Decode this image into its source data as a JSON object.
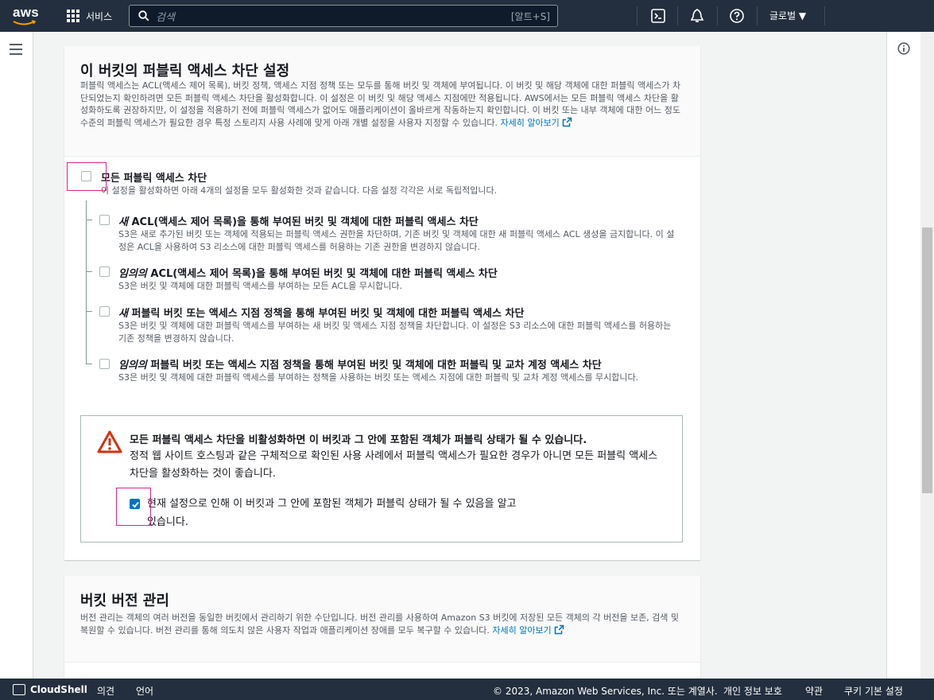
{
  "topnav": {
    "logo_text": "aws",
    "services_label": "서비스",
    "search_placeholder": "검색",
    "search_shortcut": "[알트+S]",
    "region_label": "글로벌 ▼",
    "icons": [
      "cloudshell-icon",
      "bell-icon",
      "help-icon"
    ]
  },
  "block_public_access": {
    "title": "이 버킷의 퍼블릭 액세스 차단 설정",
    "description": "퍼블릭 액세스는 ACL(액세스 제어 목록), 버킷 정책, 액세스 지점 정책 또는 모두를 통해 버킷 및 객체에 부여됩니다. 이 버킷 및 해당 객체에 대한 퍼블릭 액세스가 차단되었는지 확인하려면 모든 퍼블릭 액세스 차단을 활성화합니다. 이 설정은 이 버킷 및 해당 액세스 지점에만 적용됩니다. AWS에서는 모든 퍼블릭 액세스 차단을 활성화하도록 권장하지만, 이 설정을 적용하기 전에 퍼블릭 액세스가 없어도 애플리케이션이 올바르게 작동하는지 확인합니다. 이 버킷 또는 내부 객체에 대한 어느 정도 수준의 퍼블릭 액세스가 필요한 경우 특정 스토리지 사용 사례에 맞게 아래 개별 설정을 사용자 지정할 수 있습니다.",
    "learn_more": "자세히 알아보기",
    "block_all": {
      "label": "모든 퍼블릭 액세스 차단",
      "desc": "이 설정을 활성화하면 아래 4개의 설정을 모두 활성화한 것과 같습니다. 다음 설정 각각은 서로 독립적입니다.",
      "checked": false
    },
    "options": [
      {
        "em": "새",
        "label": " ACL(액세스 제어 목록)을 통해 부여된 버킷 및 객체에 대한 퍼블릭 액세스 차단",
        "desc": "S3은 새로 추가된 버킷 또는 객체에 적용되는 퍼블릭 액세스 권한을 차단하며, 기존 버킷 및 객체에 대한 새 퍼블릭 액세스 ACL 생성을 금지합니다. 이 설정은 ACL을 사용하여 S3 리소스에 대한 퍼블릭 액세스를 허용하는 기존 권한을 변경하지 않습니다.",
        "checked": false
      },
      {
        "em": "임의의",
        "label": " ACL(액세스 제어 목록)을 통해 부여된 버킷 및 객체에 대한 퍼블릭 액세스 차단",
        "desc": "S3은 버킷 및 객체에 대한 퍼블릭 액세스를 부여하는 모든 ACL을 무시합니다.",
        "checked": false
      },
      {
        "em": "새",
        "label": " 퍼블릭 버킷 또는 액세스 지점 정책을 통해 부여된 버킷 및 객체에 대한 퍼블릭 액세스 차단",
        "desc": "S3은 버킷 및 객체에 대한 퍼블릭 액세스를 부여하는 새 버킷 및 액세스 지점 정책을 차단합니다. 이 설정은 S3 리소스에 대한 퍼블릭 액세스를 허용하는 기존 정책을 변경하지 않습니다.",
        "checked": false
      },
      {
        "em": "임의의",
        "label": " 퍼블릭 버킷 또는 액세스 지점 정책을 통해 부여된 버킷 및 객체에 대한 퍼블릭 및 교차 계정 액세스 차단",
        "desc": "S3은 버킷 및 객체에 대한 퍼블릭 액세스를 부여하는 정책을 사용하는 버킷 또는 액세스 지점에 대한 퍼블릭 및 교차 계정 액세스를 무시합니다.",
        "checked": false
      }
    ],
    "alert": {
      "title": "모든 퍼블릭 액세스 차단을 비활성화하면 이 버킷과 그 안에 포함된 객체가 퍼블릭 상태가 될 수 있습니다.",
      "desc": "정적 웹 사이트 호스팅과 같은 구체적으로 확인된 사용 사례에서 퍼블릭 액세스가 필요한 경우가 아니면 모든 퍼블릭 액세스 차단을 활성화하는 것이 좋습니다.",
      "ack_label": "현재 설정으로 인해 이 버킷과 그 안에 포함된 객체가 퍼블릭 상태가 될 수 있음을 알고 있습니다.",
      "ack_checked": true
    }
  },
  "versioning": {
    "title": "버킷 버전 관리",
    "description": "버전 관리는 객체의 여러 버전을 동일한 버킷에서 관리하기 위한 수단입니다. 버전 관리를 사용하여 Amazon S3 버킷에 저장된 모든 객체의 각 버전을 보존, 검색 및 복원할 수 있습니다. 버전 관리를 통해 의도치 않은 사용자 작업과 애플리케이션 장애를 모두 복구할 수 있습니다.",
    "learn_more": "자세히 알아보기"
  },
  "footer": {
    "cloudshell": "CloudShell",
    "feedback": "의견",
    "language": "언어",
    "copyright": "© 2023, Amazon Web Services, Inc. 또는 계열사.",
    "privacy": "개인 정보 보호",
    "terms": "약관",
    "cookies": "쿠키 기본 설정"
  }
}
